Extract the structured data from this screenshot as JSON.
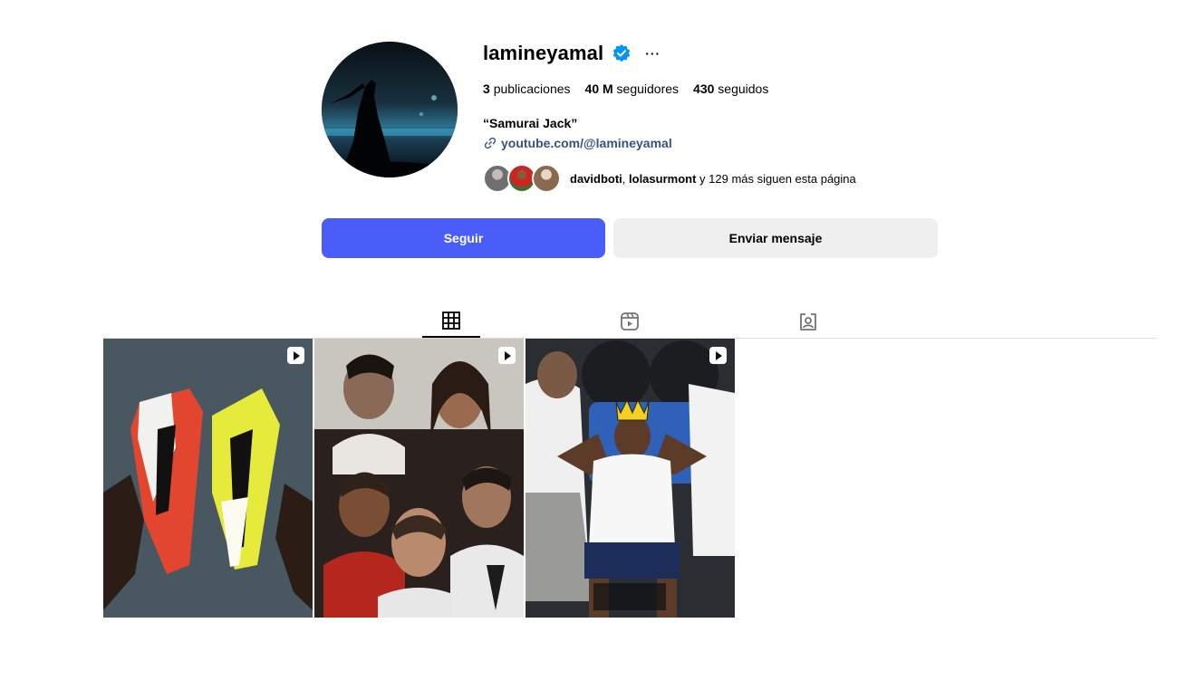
{
  "profile": {
    "username": "lamineyamal",
    "more_label": "···",
    "verified_icon": "verified-badge-icon",
    "accent_color": "#4a5df9",
    "verified_color": "#0095f6"
  },
  "stats": {
    "posts_count": "3",
    "posts_label": "publicaciones",
    "followers_count": "40 M",
    "followers_label": "seguidores",
    "following_count": "430",
    "following_label": "seguidos"
  },
  "bio": {
    "name": "“Samurai Jack”",
    "link": "youtube.com/@lamineyamal"
  },
  "followed_by": {
    "user1": "davidboti",
    "separator": ", ",
    "user2": "lolasurmont",
    "rest": " y 129 más siguen esta página"
  },
  "buttons": {
    "follow": "Seguir",
    "message": "Enviar mensaje"
  },
  "tabs": [
    {
      "icon": "grid-icon",
      "active": true
    },
    {
      "icon": "reels-icon",
      "active": false
    },
    {
      "icon": "tagged-icon",
      "active": false
    }
  ],
  "posts": [
    {
      "type": "reel",
      "icon": "reel-icon"
    },
    {
      "type": "reel",
      "icon": "reel-icon"
    },
    {
      "type": "reel",
      "icon": "reel-icon"
    }
  ]
}
